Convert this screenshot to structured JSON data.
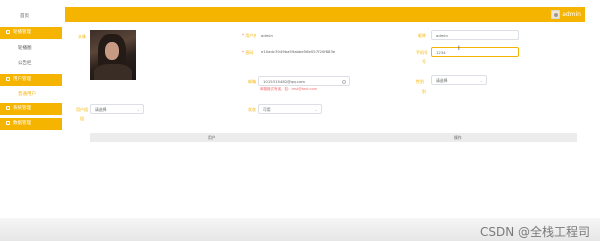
{
  "sidebar": {
    "items": [
      {
        "label": "首页",
        "kind": "home"
      },
      {
        "label": "轮播管理",
        "kind": "parent"
      },
      {
        "label": "轮播图",
        "kind": "sub"
      },
      {
        "label": "公告栏",
        "kind": "sub"
      },
      {
        "label": "用户管理",
        "kind": "parent"
      },
      {
        "label": "普通用户",
        "kind": "sub-active"
      },
      {
        "label": "系统管理",
        "kind": "parent"
      },
      {
        "label": "数据管理",
        "kind": "parent"
      }
    ]
  },
  "topbar": {
    "username": "admin",
    "avatar_icon": "user-avatar-icon"
  },
  "form": {
    "avatar_label": "头像",
    "username_label": "用户名",
    "username_value": "admin",
    "nickname_label": "昵称",
    "nickname_value": "admin",
    "password_label": "密码",
    "password_value": "e10adc3949ba59abbe56e057f20f883e",
    "phone_label": "手机号",
    "phone_value": "1234",
    "email_label": "邮箱",
    "email_value": "1015315482@qq.com",
    "email_hint": "邮箱格式有误，如：test@test.com",
    "gender_label": "性别",
    "gender_value": "请选择",
    "group_label": "用户组",
    "group_value": "请选择",
    "status_label": "状态",
    "status_value": "可用"
  },
  "table": {
    "headers": [
      "用户",
      "操作"
    ]
  },
  "watermark": "CSDN @全栈工程司",
  "colors": {
    "accent": "#f5b400",
    "error": "#f56c6c"
  }
}
